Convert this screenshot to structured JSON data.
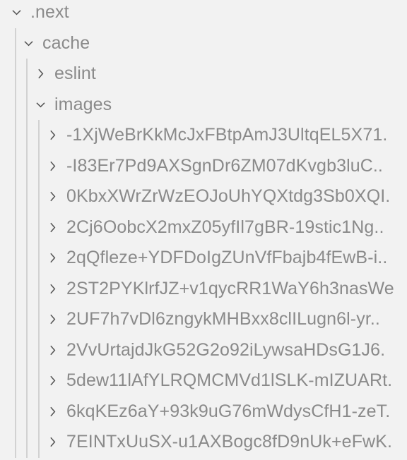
{
  "view": {
    "kind": "file-tree",
    "background_color": "#f2f2f2",
    "text_color": "#8a8a8a",
    "chevron_color": "#555555",
    "guide_color": "#d2d2d2"
  },
  "icons": {
    "expanded": "chevron-down-icon",
    "collapsed": "chevron-right-icon"
  },
  "tree": {
    "rows": [
      {
        "label": ".next",
        "depth": 0,
        "state": "expanded"
      },
      {
        "label": "cache",
        "depth": 1,
        "state": "expanded"
      },
      {
        "label": "eslint",
        "depth": 2,
        "state": "collapsed"
      },
      {
        "label": "images",
        "depth": 2,
        "state": "expanded"
      },
      {
        "label": "-1XjWeBrKkMcJxFBtpAmJ3UltqEL5X71.",
        "depth": 3,
        "state": "collapsed"
      },
      {
        "label": "-I83Er7Pd9AXSgnDr6ZM07dKvgb3luC..",
        "depth": 3,
        "state": "collapsed"
      },
      {
        "label": "0KbxXWrZrWzEOJoUhYQXtdg3Sb0XQI.",
        "depth": 3,
        "state": "collapsed"
      },
      {
        "label": "2Cj6OobcX2mxZ05yfIl7gBR-19stic1Ng..",
        "depth": 3,
        "state": "collapsed"
      },
      {
        "label": "2qQfleze+YDFDoIgZUnVfFbajb4fEwB-i..",
        "depth": 3,
        "state": "collapsed"
      },
      {
        "label": "2ST2PYKlrfJZ+v1qycRR1WaY6h3nasWe",
        "depth": 3,
        "state": "collapsed"
      },
      {
        "label": "2UF7h7vDl6zngykMHBxx8clILugn6l-yr..",
        "depth": 3,
        "state": "collapsed"
      },
      {
        "label": "2VvUrtajdJkG52G2o92iLywsaHDsG1J6.",
        "depth": 3,
        "state": "collapsed"
      },
      {
        "label": "5dew11lAfYLRQMCMVd1lSLK-mIZUARt.",
        "depth": 3,
        "state": "collapsed"
      },
      {
        "label": "6kqKEz6aY+93k9uG76mWdysCfH1-zeT.",
        "depth": 3,
        "state": "collapsed"
      },
      {
        "label": "7EINTxUuSX-u1AXBogc8fD9nUk+eFwK.",
        "depth": 3,
        "state": "collapsed"
      }
    ]
  }
}
